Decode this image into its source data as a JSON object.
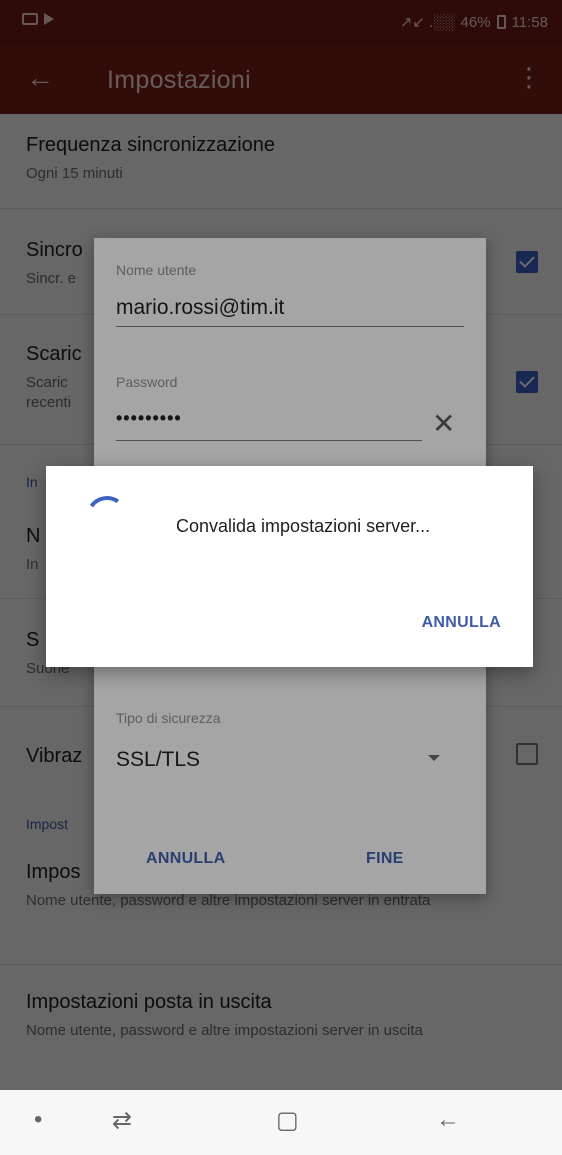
{
  "status_bar": {
    "time": "11:58",
    "battery": "46%",
    "signal": "↗↙ .░░",
    "icons": [
      "gallery-icon",
      "play-icon",
      "mute-icon",
      "wifi-calling-icon",
      "signal-icon",
      "battery-icon"
    ]
  },
  "app_bar": {
    "title": "Impostazioni",
    "back_icon": "←",
    "menu_icon": "⋮"
  },
  "settings": {
    "sync_frequency": {
      "title": "Frequenza sincronizzazione",
      "subtitle": "Ogni 15 minuti"
    },
    "sync_row": {
      "title": "Sincro",
      "subtitle": "Sincr. e"
    },
    "download_row": {
      "title": "Scaric",
      "subtitle_1": "Scaric",
      "subtitle_2": "recenti"
    },
    "section_notifications": "In",
    "notify_row": {
      "title": "N",
      "subtitle": "In"
    },
    "sound_row": {
      "title": "S",
      "subtitle": "Suone"
    },
    "vibration_row": {
      "title": "Vibraz"
    },
    "section_server": "Impost",
    "incoming_row": {
      "title": "Impos",
      "subtitle": "Nome utente, password e altre impostazioni server in entrata"
    },
    "outgoing_row": {
      "title": "Impostazioni posta in uscita",
      "subtitle": "Nome utente, password e altre impostazioni server in uscita"
    }
  },
  "account_dialog": {
    "username_label": "Nome utente",
    "username_value": "mario.rossi@tim.it",
    "password_label": "Password",
    "password_value": "•••••••••",
    "clear_icon": "✕",
    "security_label": "Tipo di sicurezza",
    "security_value": "SSL/TLS",
    "cancel_label": "ANNULLA",
    "done_label": "FINE"
  },
  "progress_dialog": {
    "message": "Convalida impostazioni server...",
    "cancel_label": "ANNULLA"
  },
  "nav_bar": {
    "dot": "•",
    "recents": "⇄",
    "home": "▢",
    "back": "←"
  },
  "colors": {
    "app_bar": "#7a1e17",
    "accent": "#3d62c4",
    "link": "#3f5ca8"
  }
}
